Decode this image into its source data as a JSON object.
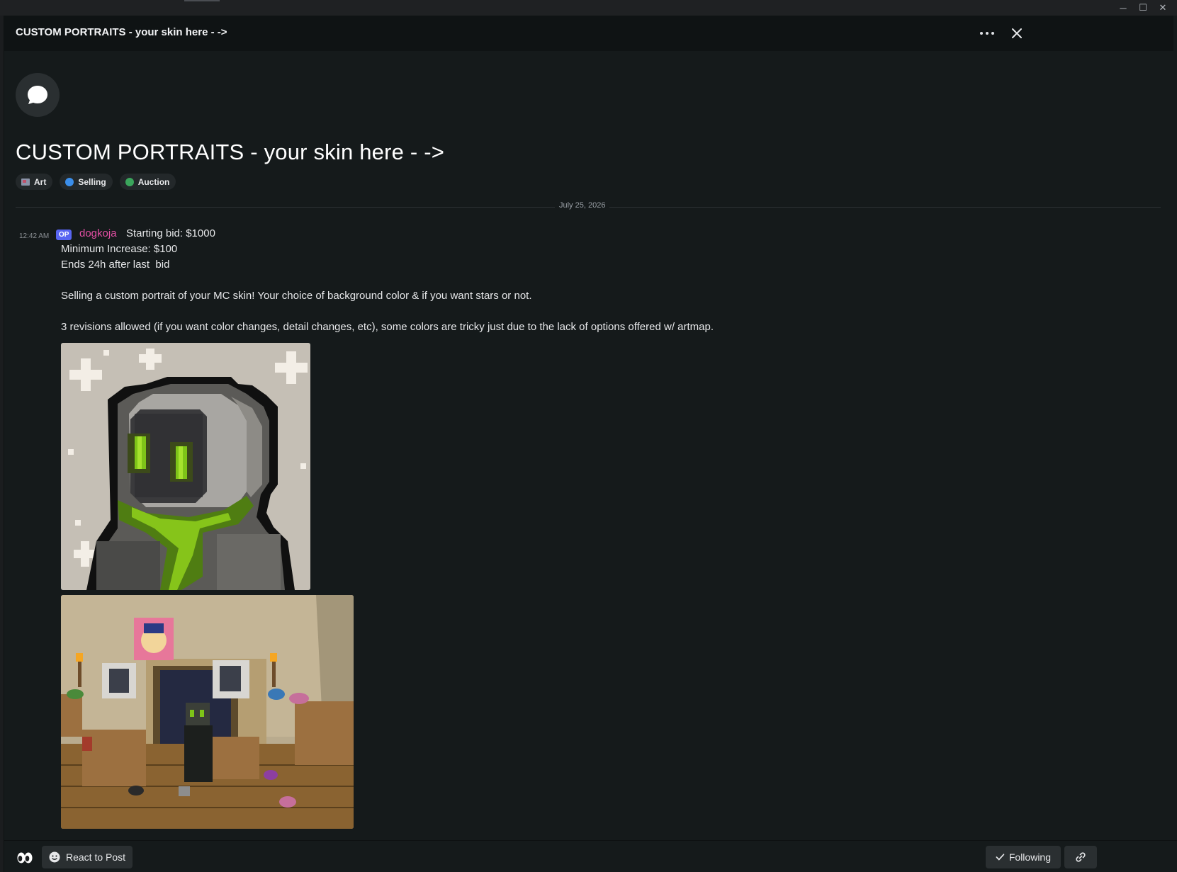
{
  "window": {
    "minimize": "─",
    "maximize": "☐",
    "close": "✕"
  },
  "header": {
    "title": "CUSTOM PORTRAITS - your skin here - ->"
  },
  "post": {
    "title": "CUSTOM PORTRAITS - your skin here - ->",
    "tags": [
      {
        "label": "Art",
        "icon": "picture-icon"
      },
      {
        "label": "Selling",
        "color": "#3b8eea"
      },
      {
        "label": "Auction",
        "color": "#3ba55c"
      }
    ],
    "date_divider": "July 25, 2026"
  },
  "message": {
    "timestamp": "12:42 AM",
    "badge": "OP",
    "author": "dogkoja",
    "lines": [
      "Starting bid: $1000",
      "Minimum Increase: $100",
      "Ends 24h after last  bid",
      "Selling a custom portrait of your MC skin! Your choice of background color & if you want stars or not.",
      "3 revisions allowed (if you want color changes, detail changes, etc), some colors are tricky just due to the lack of options offered w/ artmap."
    ],
    "attachments": [
      "portrait-image",
      "room-screenshot-image"
    ]
  },
  "footer": {
    "react_label": "React to Post",
    "following_label": "Following"
  },
  "colors": {
    "author": "#e34fa4",
    "op_badge": "#5865f2",
    "accent_green": "#7ec418"
  }
}
